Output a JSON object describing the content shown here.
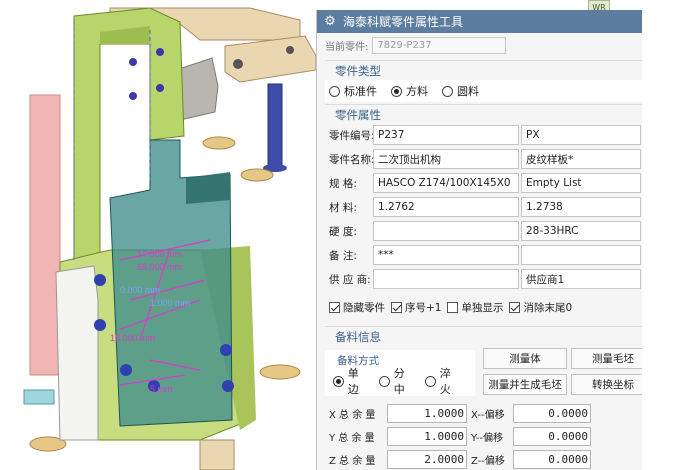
{
  "panel": {
    "title": "海泰科赋零件属性工具",
    "current_label": "当前零件:",
    "current_value": "7829-P237"
  },
  "part_type": {
    "header": "零件类型",
    "options": [
      "标准件",
      "方料",
      "圆料"
    ],
    "selected": 1
  },
  "properties": {
    "header": "零件属性",
    "rows": [
      {
        "label": "零件编号:",
        "value": "P237",
        "extra": "PX"
      },
      {
        "label": "零件名称:",
        "value": "二次顶出机构",
        "extra": "皮纹样板*"
      },
      {
        "label": "规    格:",
        "value": "HASCO Z174/100X145X0",
        "extra": "Empty List"
      },
      {
        "label": "材    料:",
        "value": "1.2762",
        "extra": "1.2738"
      },
      {
        "label": "硬    度:",
        "value": "",
        "extra": "28-33HRC"
      },
      {
        "label": "备    注:",
        "value": "***",
        "extra": ""
      },
      {
        "label": "供 应 商:",
        "value": "",
        "extra": "供应商1"
      }
    ]
  },
  "checks": [
    {
      "label": "隐藏零件",
      "checked": true
    },
    {
      "label": "序号+1",
      "checked": true
    },
    {
      "label": "单独显示",
      "checked": false
    },
    {
      "label": "消除末尾0",
      "checked": true
    }
  ],
  "stock": {
    "header": "备料信息",
    "method_title": "备料方式",
    "methods": [
      "单边",
      "分中",
      "淬火"
    ],
    "selected": 0,
    "buttons": {
      "measure_body": "测量体",
      "measure_blank": "测量毛坯",
      "measure_generate": "测量并生成毛坯",
      "convert_coords": "转换坐标"
    },
    "allowances": [
      {
        "label": "X 总 余 量",
        "value": "1.0000",
        "offset_label": "X--偏移",
        "offset": "0.0000"
      },
      {
        "label": "Y 总 余 量",
        "value": "1.0000",
        "offset_label": "Y--偏移",
        "offset": "0.0000"
      },
      {
        "label": "Z 总 余 量",
        "value": "2.0000",
        "offset_label": "Z--偏移",
        "offset": "0.0000"
      }
    ]
  },
  "viewport": {
    "annotations": [
      "17.000 mm",
      "65.000 mm",
      "0.000 mm",
      "1.000 mm",
      "18.000 mm",
      "5 mm"
    ]
  },
  "corner_badge": "WR",
  "colors": {
    "title_bar": "#5c7d9f",
    "section_text": "#3b5f8a",
    "part_green": "#b6d56a",
    "part_tan": "#e9d6b2",
    "part_teal": "#3f8d8a",
    "annotation_magenta": "#d93ccf"
  }
}
